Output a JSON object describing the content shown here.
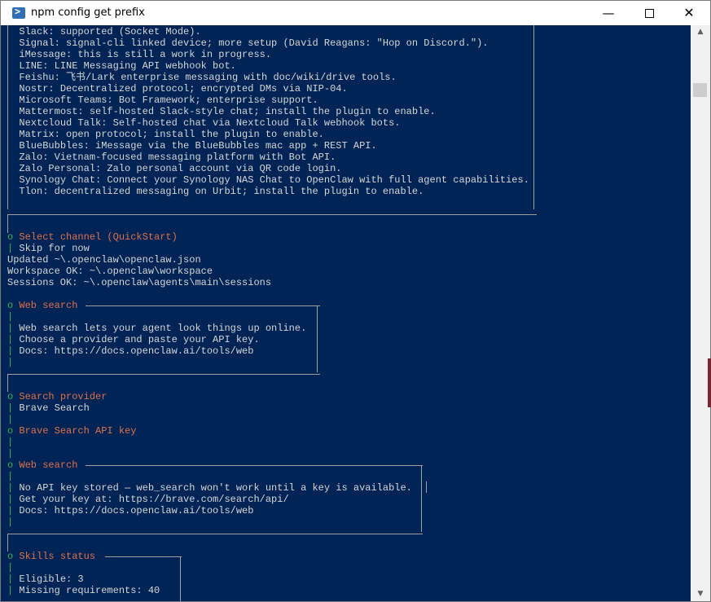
{
  "window": {
    "title": "npm config get prefix",
    "min": "—",
    "close": "✕"
  },
  "console": {
    "lines": [
      "Slack: supported (Socket Mode).",
      "Signal: signal-cli linked device; more setup (David Reagans: \"Hop on Discord.\").",
      "iMessage: this is still a work in progress.",
      "LINE: LINE Messaging API webhook bot.",
      "Feishu: 飞书/Lark enterprise messaging with doc/wiki/drive tools.",
      "Nostr: Decentralized protocol; encrypted DMs via NIP-04.",
      "Microsoft Teams: Bot Framework; enterprise support.",
      "Mattermost: self-hosted Slack-style chat; install the plugin to enable.",
      "Nextcloud Talk: Self-hosted chat via Nextcloud Talk webhook bots.",
      "Matrix: open protocol; install the plugin to enable.",
      "BlueBubbles: iMessage via the BlueBubbles mac app + REST API.",
      "Zalo: Vietnam-focused messaging platform with Bot API.",
      "Zalo Personal: Zalo personal account via QR code login.",
      "Synology Chat: Connect your Synology NAS Chat to OpenClaw with full agent capabilities.",
      "Tlon: decentralized messaging on Urbit; install the plugin to enable.",
      "",
      "",
      "",
      "Select channel (QuickStart)",
      "Skip for now",
      "Updated ~\\.openclaw\\openclaw.json",
      "Workspace OK: ~\\.openclaw\\workspace",
      "Sessions OK: ~\\.openclaw\\agents\\main\\sessions",
      "",
      "Web search",
      "",
      "Web search lets your agent look things up online.",
      "Choose a provider and paste your API key.",
      "Docs: https://docs.openclaw.ai/tools/web",
      "",
      "",
      "",
      "Search provider",
      "Brave Search",
      "",
      "Brave Search API key",
      "",
      "",
      "Web search",
      "",
      "No API key stored — web_search won't work until a key is available.",
      "Get your key at: https://brave.com/search/api/",
      "Docs: https://docs.openclaw.ai/tools/web",
      "",
      "",
      "",
      "Skills status",
      "",
      "Eligible: 3",
      "Missing requirements: 40"
    ],
    "markers": {
      "dot": "o",
      "pipe": "|",
      "diamond": "◇"
    }
  },
  "colors": {
    "console_bg": "#012456",
    "text": "#d6d6d6",
    "heading": "#e0704a",
    "marker": "#3fae5a"
  }
}
